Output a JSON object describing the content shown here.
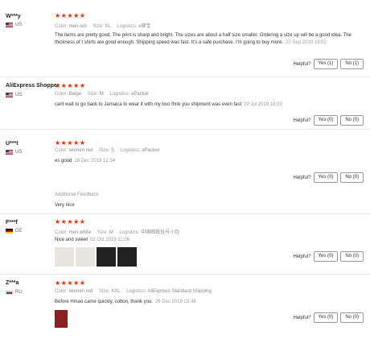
{
  "accent_color": "#e62e04",
  "helpful_label": "Helpful?",
  "reviews": [
    {
      "name": "W***y",
      "country": "US",
      "stars": "★★★★★",
      "color_label": "Color:",
      "color": "men red",
      "size_label": "Size:",
      "size": "XL",
      "logistics_label": "Logistics:",
      "logistics": "e邮宝",
      "text": "The items are pretty good. The print is sharp and bright. The sizes are about a half size smaller. Ordering a size up will be a good idea. The thickness of t shirts are good enough. Shipping speed was fast. It's a safe purchase. I'm going to buy more.",
      "date": "27 Sep 2019 19:02",
      "yes": "Yes (1)",
      "no": "No (1)"
    },
    {
      "name": "AliExpress Shopper",
      "country": "US",
      "stars": "★★★★★",
      "color_label": "Color:",
      "color": "Beige",
      "size_label": "Size:",
      "size": "M",
      "logistics_label": "Logistics:",
      "logistics": "ePacket",
      "text": "cant wait to go back to Jamaica to wear it with my boo thnk you shipment was even fast",
      "date": "20 Jul 2019 18:03",
      "yes": "Yes (0)",
      "no": "No (0)"
    },
    {
      "name": "U***t",
      "country": "US",
      "stars": "★★★★★",
      "color_label": "Color:",
      "color": "women red",
      "size_label": "Size:",
      "size": "S",
      "logistics_label": "Logistics:",
      "logistics": "ePacket",
      "text": "es good",
      "date": "18 Dec 2019 12:34",
      "yes": "Yes (0)",
      "no": "No (0)",
      "additional_title": "Additional Feedback",
      "additional_text": "Very nice"
    },
    {
      "name": "F***f",
      "country": "DE",
      "stars": "★★★★★",
      "color_label": "Color:",
      "color": "men white",
      "size_label": "Size:",
      "size": "M",
      "logistics_label": "Logistics:",
      "logistics": "中国邮政挂号小包",
      "text": "Nice and sweet",
      "date": "02 Oct 2019 11:06",
      "yes": "Yes (0)",
      "no": "No (0)"
    },
    {
      "name": "Z***a",
      "country": "RU",
      "stars": "★★★★★",
      "color_label": "Color:",
      "color": "women red",
      "size_label": "Size:",
      "size": "XXL",
      "logistics_label": "Logistics:",
      "logistics": "AliExpress Standard Shipping",
      "text": "Before Hmao came quickly, cotton, thank you.",
      "date": "26 Dec 2019 23:48",
      "yes": "Yes (0)",
      "no": "No (0)"
    }
  ]
}
